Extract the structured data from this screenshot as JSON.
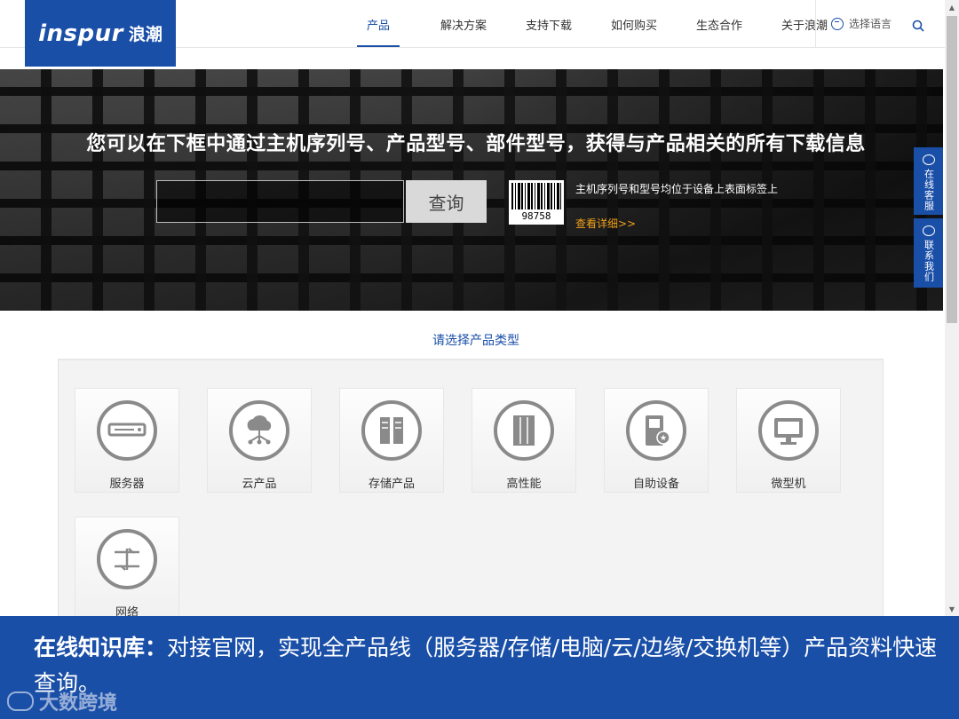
{
  "header": {
    "logo_brand": "inspur",
    "logo_brand_cn": "浪潮",
    "nav": [
      "产品",
      "解决方案",
      "支持下载",
      "如何购买",
      "生态合作",
      "关于浪潮"
    ],
    "active_nav": "产品",
    "language_label": "选择语言"
  },
  "banner": {
    "title": "您可以在下框中通过主机序列号、产品型号、部件型号，获得与产品相关的所有下载信息",
    "query_button": "查询",
    "barcode_number": "98758",
    "hint": "主机序列号和型号均位于设备上表面标签上",
    "detail_link": "查看详细>>"
  },
  "side_buttons": {
    "chat": "在线客服",
    "contact": "联系我们"
  },
  "products": {
    "section_title": "请选择产品类型",
    "items": [
      {
        "label": "服务器",
        "icon": "server-icon"
      },
      {
        "label": "云产品",
        "icon": "cloud-icon"
      },
      {
        "label": "存储产品",
        "icon": "storage-icon"
      },
      {
        "label": "高性能",
        "icon": "hpc-icon"
      },
      {
        "label": "自助设备",
        "icon": "kiosk-icon"
      },
      {
        "label": "微型机",
        "icon": "desktop-icon"
      },
      {
        "label": "网络",
        "icon": "network-icon"
      }
    ]
  },
  "caption": {
    "bold": "在线知识库：",
    "text": "对接官网，实现全产品线（服务器/存储/电脑/云/边缘/交换机等）产品资料快速查询。"
  },
  "watermark": "大数跨境",
  "colors": {
    "brand_blue": "#1a4fa8",
    "link_orange": "#f2a11a",
    "icon_gray": "#8a8a8a"
  }
}
